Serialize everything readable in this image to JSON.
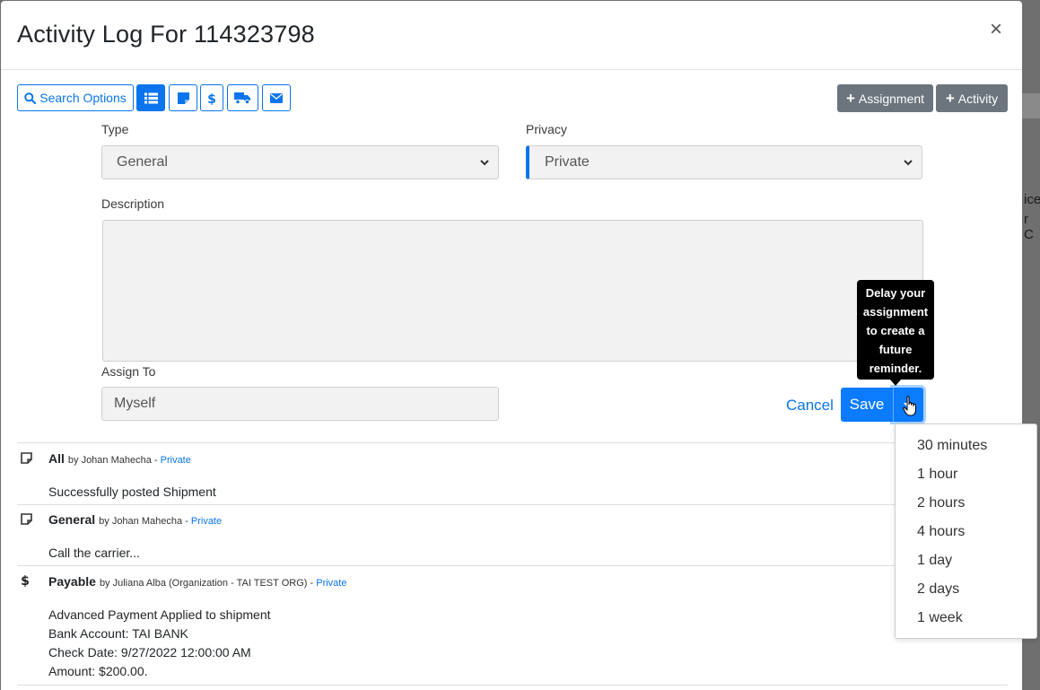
{
  "modal": {
    "title": "Activity Log For 114323798",
    "close_label": "×"
  },
  "background": {
    "side_text_1": "ice",
    "side_text_2": "r C"
  },
  "toolbar": {
    "search_label": "Search Options",
    "assignment_label": "Assignment",
    "activity_label": "Activity"
  },
  "form": {
    "type_label": "Type",
    "type_value": "General",
    "privacy_label": "Privacy",
    "privacy_value": "Private",
    "description_label": "Description",
    "assign_label": "Assign To",
    "assign_value": "Myself",
    "cancel_label": "Cancel",
    "save_label": "Save"
  },
  "tooltip": {
    "lines": [
      "Delay your",
      "assignment",
      "to create a",
      "future",
      "reminder."
    ]
  },
  "delay_menu": {
    "items": [
      "30 minutes",
      "1 hour",
      "2 hours",
      "4 hours",
      "1 day",
      "2 days",
      "1 week"
    ]
  },
  "activities": [
    {
      "icon": "note-icon",
      "title": "All",
      "by": "by Johan Mahecha -",
      "privacy": "Private",
      "lines": [
        "Successfully posted Shipment"
      ]
    },
    {
      "icon": "note-icon",
      "title": "General",
      "by": "by Johan Mahecha -",
      "privacy": "Private",
      "lines": [
        "Call the carrier..."
      ]
    },
    {
      "icon": "dollar-icon",
      "title": "Payable",
      "by": "by Juliana Alba (Organization - TAI TEST ORG) -",
      "privacy": "Private",
      "lines": [
        "Advanced Payment Applied to shipment",
        "Bank Account: TAI BANK",
        "Check Date: 9/27/2022 12:00:00 AM",
        "Amount: $200.00."
      ]
    }
  ]
}
